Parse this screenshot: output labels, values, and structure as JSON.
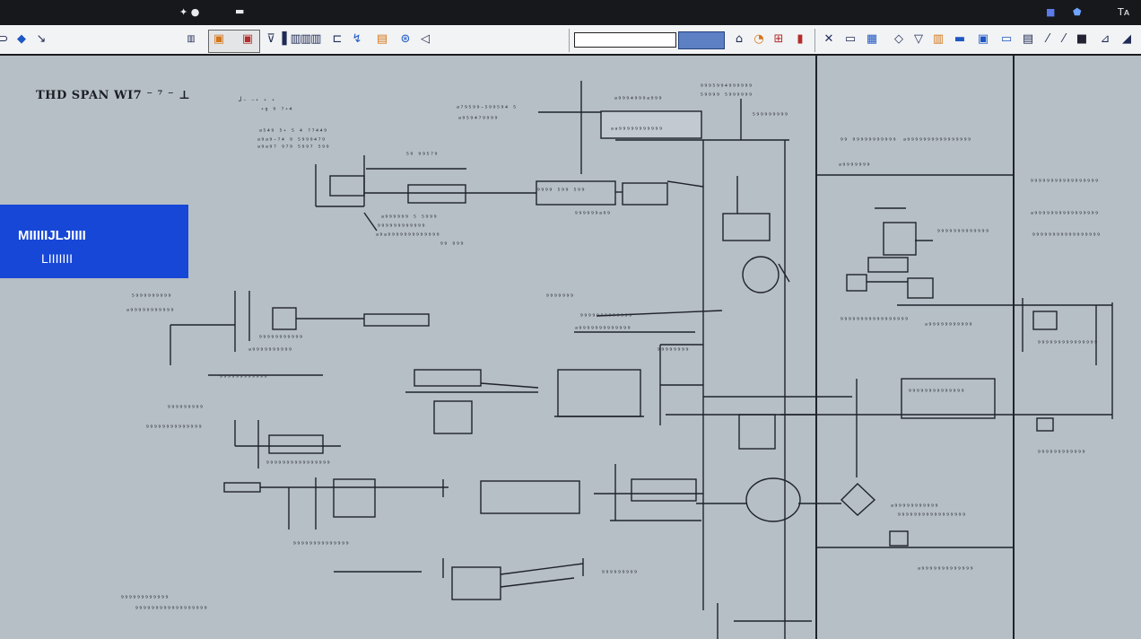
{
  "titlebar": {
    "title": "",
    "icons": [
      "✦ ●",
      "▬",
      "■",
      "⬟",
      "Tᴀ"
    ]
  },
  "toolbar": {
    "field_value": "",
    "blue_field_value": "",
    "tools": [
      "pointer-icon",
      "paint-icon",
      "select-icon",
      "grid-icon",
      "layer-icon",
      "lock-icon",
      "filter-icon",
      "table-icon",
      "link-icon",
      "folder-icon",
      "globe-icon",
      "cursor-icon",
      "text-icon",
      "image-icon",
      "wrench-icon",
      "pencil-icon",
      "cut-icon",
      "frame-icon",
      "window-icon",
      "diamond-icon",
      "funnel-icon",
      "bucket-icon",
      "panel-icon",
      "chip-icon",
      "screen-icon",
      "note-icon",
      "pen-icon",
      "brush-icon",
      "square-icon",
      "angle-icon"
    ]
  },
  "diagram": {
    "title": "THD SPAN  WI7 ⁻ ⁷ ⁻ ⊥",
    "layer_panel": {
      "line1": "MIIIIIJLJIIII",
      "line2": "LIIIIIII"
    },
    "labels": [
      {
        "t": "┘⁻ ⁻⁺ ⁺ ⁺"
      },
      {
        "t": "⁺ᵍ ⁹ ⁷⁺⁴"
      },
      {
        "t": "ᵃ⁵⁴⁹ ⁵⁺ ⁵  ⁴ ⁷⁷⁴⁴⁹"
      },
      {
        "t": "ᵃ⁹ᵃ⁹⁻⁷⁴  ⁹  ⁵⁹⁹⁹⁴⁷⁹"
      },
      {
        "t": "ᵃ⁹ᵃ⁹⁷ ⁹⁷⁹ ⁵⁹⁹⁷ ⁵⁹⁹"
      },
      {
        "t": "⁵⁹ ⁹⁹⁵⁷⁹"
      },
      {
        "t": "ᵃ⁷⁹⁵⁹⁹⁻⁵⁹⁹⁵⁹⁴ ⁵"
      },
      {
        "t": "ᵃ⁹⁵⁹⁴⁷⁹⁹⁹⁹"
      },
      {
        "t": "⁹⁹⁹⁵⁹⁹⁴⁹⁹⁹⁹⁹⁹"
      },
      {
        "t": "⁵⁹⁹⁹⁹ ⁵⁹⁹⁹⁹⁹⁹"
      },
      {
        "t": "ᵃ⁹⁹⁹⁴⁹⁹⁹ᵃ⁹⁹⁹"
      },
      {
        "t": "ᵃᵃ⁹⁹⁹⁹⁹⁹⁹⁹⁹⁹⁹"
      },
      {
        "t": "⁵⁹⁹⁹⁹⁹⁹⁹⁹"
      },
      {
        "t": "⁹⁹⁹⁹ ⁵⁹⁹ ⁵⁹⁹"
      },
      {
        "t": "⁹⁹⁹⁹⁹⁹ᵃ⁹⁹"
      },
      {
        "t": "ᵃ⁹⁹⁹⁹⁹⁹ ⁵ ⁵⁹⁹⁹"
      },
      {
        "t": "⁹⁹⁹⁹⁹⁹⁹⁹⁹⁹⁹⁹"
      },
      {
        "t": "ᵃ⁹ᵃ⁹⁹⁹⁹⁹⁹⁹⁹⁹⁹⁹⁹⁹"
      },
      {
        "t": "⁹⁹ ⁹⁹⁹"
      },
      {
        "t": "⁹⁹ ⁹⁹⁹⁹⁹⁹⁹⁹⁹⁹⁹"
      },
      {
        "t": "ᵃ⁹⁹⁹⁹⁹⁹⁹⁹⁹⁹⁹⁹⁹⁹⁹⁹"
      },
      {
        "t": "ᵃ⁹⁹⁹⁹⁹⁹⁹"
      },
      {
        "t": "⁹⁹⁹⁹⁹⁹⁹⁹⁹⁹⁹⁹⁹⁹⁹⁹⁹"
      },
      {
        "t": "ᵃ⁹⁹⁹⁹⁹⁹⁹⁹⁹⁹⁹⁹⁹⁹⁹⁹"
      },
      {
        "t": "⁹⁹⁹⁹⁹⁹⁹⁹⁹⁹⁹⁹⁹⁹⁹⁹⁹"
      },
      {
        "t": "⁹⁹⁹⁹⁹⁹⁹⁹⁹⁹⁹⁹⁹"
      },
      {
        "t": "⁵⁹⁹⁹⁹⁹⁹⁹⁹⁹"
      },
      {
        "t": "ᵃ⁹⁹⁹⁹⁹⁹⁹⁹⁹⁹⁹"
      },
      {
        "t": "⁹⁹⁹⁹⁹⁹⁹"
      },
      {
        "t": "⁹⁹⁹⁹⁹⁹⁹⁹⁹⁹⁹⁹⁹"
      },
      {
        "t": "ᵃ⁹⁹⁹⁹⁹⁹⁹⁹⁹⁹⁹⁹⁹"
      },
      {
        "t": "⁹⁹⁹⁹⁹⁹⁹⁹"
      },
      {
        "t": "⁹⁹⁹⁹⁹⁹⁹⁹⁹⁹⁹"
      },
      {
        "t": "ᵃ⁹⁹⁹⁹⁹⁹⁹⁹⁹⁹"
      },
      {
        "t": "⁹⁹⁹⁹⁹⁹⁹⁹⁹⁹⁹⁹"
      },
      {
        "t": "⁹⁹⁹⁹⁹⁹⁹⁹⁹"
      },
      {
        "t": "⁹⁹⁹⁹⁹⁹⁹⁹⁹⁹⁹⁹⁹⁹"
      },
      {
        "t": "⁹⁹⁹⁹⁹⁹⁹⁹⁹⁹⁹⁹⁹⁹⁹⁹⁹"
      },
      {
        "t": "ᵃ⁹⁹⁹⁹⁹⁹⁹⁹⁹⁹⁹"
      },
      {
        "t": "⁹⁹⁹⁹⁹⁹⁹⁹⁹⁹⁹⁹⁹⁹"
      },
      {
        "t": "⁹⁹⁹⁹⁹⁹⁹⁹⁹⁹⁹⁹⁹⁹⁹"
      },
      {
        "t": "⁹⁹⁹⁹⁹⁹⁹⁹⁹⁹⁹⁹"
      },
      {
        "t": "⁹⁹⁹⁹⁹⁹⁹⁹⁹⁹⁹⁹⁹⁹⁹⁹"
      },
      {
        "t": "ᵃ⁹⁹⁹⁹⁹⁹⁹⁹⁹⁹⁹"
      },
      {
        "t": "⁹⁹⁹⁹⁹⁹⁹⁹⁹⁹⁹⁹⁹⁹⁹⁹⁹"
      },
      {
        "t": "⁹⁹⁹⁹⁹⁹⁹⁹⁹⁹⁹⁹⁹⁹"
      },
      {
        "t": "⁹⁹⁹⁹⁹⁹⁹⁹⁹⁹⁹⁹"
      },
      {
        "t": "⁹⁹⁹⁹⁹⁹⁹⁹⁹"
      },
      {
        "t": "ᵃ⁹⁹⁹⁹⁹⁹⁹⁹⁹⁹⁹⁹⁹"
      },
      {
        "t": "⁹⁹⁹⁹⁹⁹⁹⁹⁹⁹⁹⁹⁹⁹⁹⁹⁹⁹"
      }
    ]
  }
}
